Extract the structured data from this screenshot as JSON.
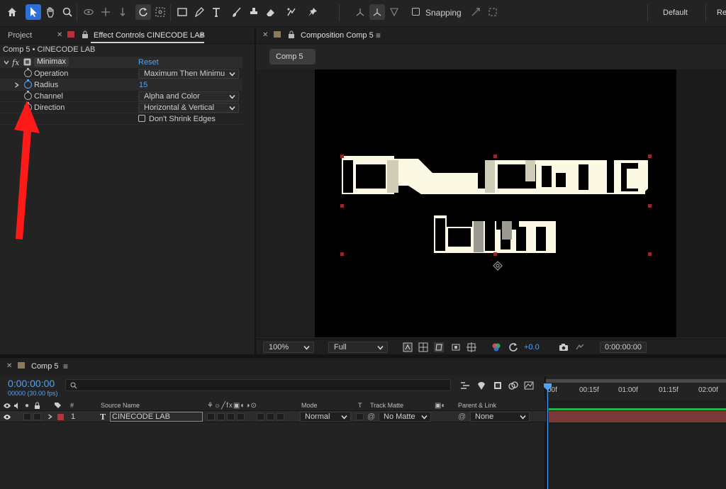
{
  "workspace": {
    "default_label": "Default",
    "review_label": "Re"
  },
  "snapping": {
    "label": "Snapping",
    "checked": false
  },
  "left_panel": {
    "project_tab": "Project",
    "effect_controls_tab": "Effect Controls CINECODE LAB",
    "header": "Comp 5 • CINECODE LAB",
    "effect": {
      "name": "Minimax",
      "reset_label": "Reset",
      "properties": [
        {
          "label": "Operation",
          "value": "Maximum Then Minimu"
        },
        {
          "label": "Radius",
          "value": "15"
        },
        {
          "label": "Channel",
          "value": "Alpha and Color"
        },
        {
          "label": "Direction",
          "value": "Horizontal & Vertical"
        }
      ],
      "dont_shrink_label": "Don't Shrink Edges",
      "dont_shrink_checked": false
    }
  },
  "comp_panel": {
    "tab_label": "Composition Comp 5",
    "subtab": "Comp 5",
    "zoom": "100%",
    "resolution": "Full",
    "exposure": "+0.0",
    "timecode": "0:00:00:00"
  },
  "timeline": {
    "tab_label": "Comp 5",
    "current_time": "0:00:00:00",
    "frames": "00000 (30.00 fps)",
    "search_placeholder": "",
    "columns": {
      "number": "#",
      "source_name": "Source Name",
      "mode": "Mode",
      "t": "T",
      "track_matte": "Track Matte",
      "parent_link": "Parent & Link"
    },
    "layers": [
      {
        "number": "1",
        "type": "T",
        "name": "CINECODE LAB",
        "mode": "Normal",
        "matte": "No Matte",
        "parent": "None"
      }
    ],
    "ruler": [
      "00f",
      "00:15f",
      "01:00f",
      "01:15f",
      "02:00f"
    ]
  },
  "colors": {
    "accent_blue": "#4ea3ff",
    "active_tool": "#2c6fd6",
    "layer_label_red": "#b8323a",
    "layer_bar": "#7a3b38",
    "text_fill": "#fbf8e3",
    "annotation_arrow": "#ff1a1a"
  }
}
